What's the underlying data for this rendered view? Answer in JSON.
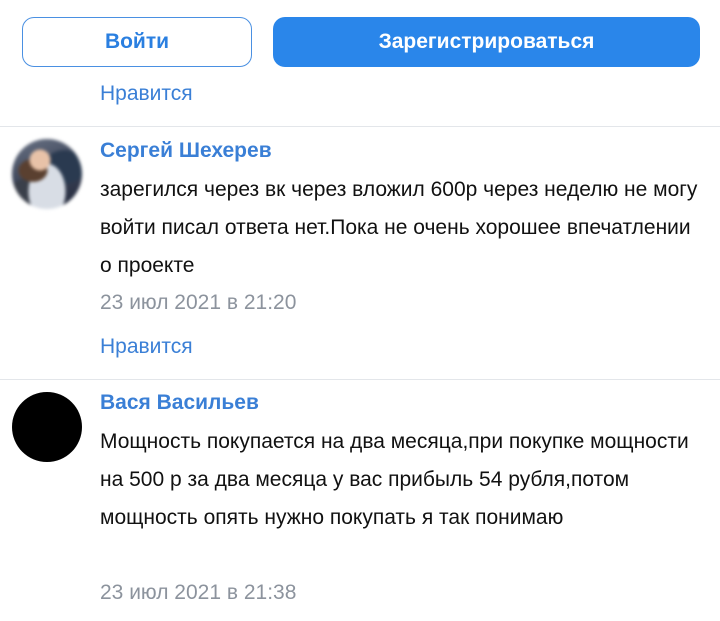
{
  "auth": {
    "login_label": "Войти",
    "register_label": "Зарегистрироваться"
  },
  "top_like_label": "Нравится",
  "comments": [
    {
      "author": "Сергей Шехерев",
      "text": "зарегился через вк через вложил 600р через неделю не могу войти писал ответа нет.Пока не очень хорошее впечатлении о проекте",
      "date": "23 июл 2021 в 21:20",
      "like_label": "Нравится"
    },
    {
      "author": "Вася Васильев",
      "text": "Мощность покупается на два месяца,при покупке мощности на 500 р за два месяца у вас прибыль 54 рубля,потом мощность опять нужно покупать я так понимаю",
      "date": "23 июл 2021 в 21:38"
    }
  ],
  "colors": {
    "accent": "#2a86ea",
    "link": "#3a7fd6",
    "muted": "#8c939d",
    "divider": "#e3e6ea"
  }
}
